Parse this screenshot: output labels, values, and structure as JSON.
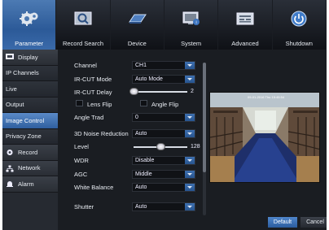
{
  "nav": {
    "tabs": [
      {
        "label": "Parameter",
        "icon": "gears-icon"
      },
      {
        "label": "Record Search",
        "icon": "magnifier-icon"
      },
      {
        "label": "Device",
        "icon": "hard-disk-icon"
      },
      {
        "label": "System",
        "icon": "monitor-icon"
      },
      {
        "label": "Advanced",
        "icon": "panel-icon"
      },
      {
        "label": "Shutdown",
        "icon": "power-icon"
      }
    ],
    "active": "Parameter"
  },
  "sidebar": {
    "items": [
      {
        "label": "Display",
        "type": "header"
      },
      {
        "label": "IP Channels",
        "type": "item"
      },
      {
        "label": "Live",
        "type": "item"
      },
      {
        "label": "Output",
        "type": "item"
      },
      {
        "label": "Image Control",
        "type": "item",
        "active": true
      },
      {
        "label": "Privacy Zone",
        "type": "item"
      },
      {
        "label": "Record",
        "type": "header"
      },
      {
        "label": "Network",
        "type": "header"
      },
      {
        "label": "Alarm",
        "type": "header"
      }
    ]
  },
  "form": {
    "channel": {
      "label": "Channel",
      "value": "CH1"
    },
    "ircut_mode": {
      "label": "IR-CUT Mode",
      "value": "Auto Mode"
    },
    "ircut_delay": {
      "label": "IR-CUT Delay",
      "value": "2",
      "level": 0.0
    },
    "lens_flip": {
      "label": "Lens Flip",
      "checked": false
    },
    "angle_flip": {
      "label": "Angle Flip",
      "checked": false
    },
    "angle_trad": {
      "label": "Angle Trad",
      "value": "0"
    },
    "noise_reduction": {
      "label": "3D Noise Reduction",
      "value": "Auto"
    },
    "level": {
      "label": "Level",
      "value": "128",
      "level": 0.5
    },
    "wdr": {
      "label": "WDR",
      "value": "Disable"
    },
    "agc": {
      "label": "AGC",
      "value": "Middle"
    },
    "white_balance": {
      "label": "White Balance",
      "value": "Auto"
    },
    "shutter": {
      "label": "Shutter",
      "value": "Auto"
    }
  },
  "preview": {
    "osd": "09-01-2016 Thu 15:45:54"
  },
  "buttons": {
    "default": "Default",
    "cancel": "Cancel"
  },
  "colors": {
    "accent": "#2f5f9e",
    "background": "#1c1f25"
  }
}
